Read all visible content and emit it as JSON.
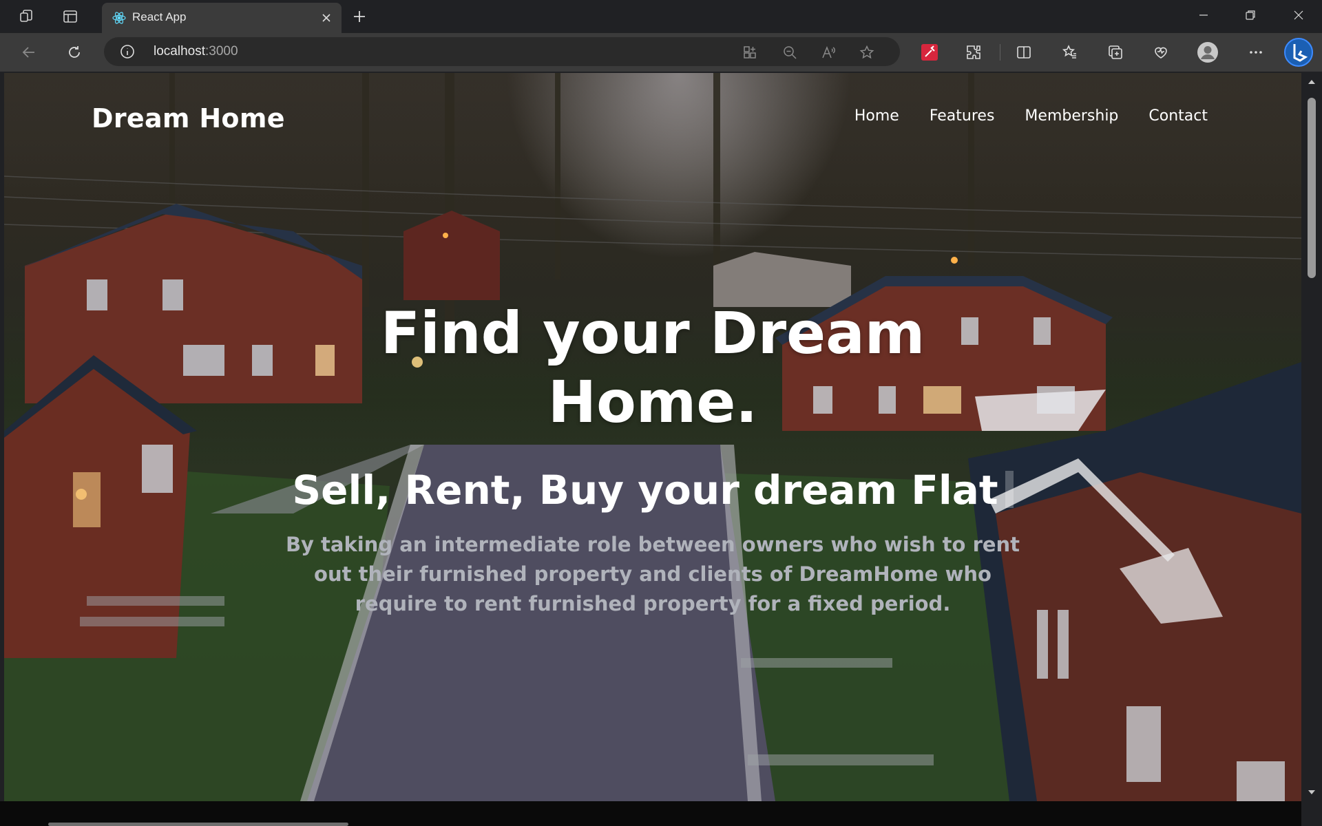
{
  "browser": {
    "tab_title": "React App",
    "url_host": "localhost",
    "url_port": ":3000"
  },
  "site": {
    "logo": "Dream Home",
    "nav": [
      "Home",
      "Features",
      "Membership",
      "Contact"
    ],
    "hero_title_line1": "Find your Dream",
    "hero_title_line2": "Home.",
    "hero_subtitle": "Sell, Rent, Buy your dream Flat",
    "hero_description": "By taking an intermediate role between owners who wish to rent out their furnished property and clients of DreamHome who require to rent furnished property for a fixed period."
  },
  "colors": {
    "tab_active": "#3b3b3b",
    "chrome_bg": "#202124",
    "accent": "#1a73e8"
  }
}
